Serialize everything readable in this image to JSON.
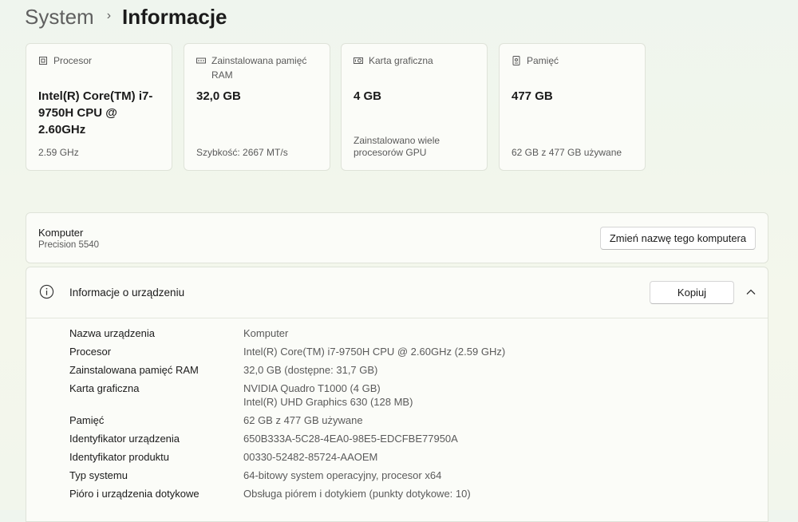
{
  "breadcrumb": {
    "parent": "System",
    "separator": "›",
    "current": "Informacje"
  },
  "cards": [
    {
      "icon": "cpu-icon",
      "label": "Procesor",
      "value": "Intel(R) Core(TM) i7-9750H CPU @ 2.60GHz",
      "detail": "2.59 GHz"
    },
    {
      "icon": "ram-icon",
      "label": "Zainstalowana pamięć RAM",
      "value": "32,0 GB",
      "detail": "Szybkość: 2667 MT/s"
    },
    {
      "icon": "gpu-icon",
      "label": "Karta graficzna",
      "value": "4 GB",
      "detail": "Zainstalowano wiele procesorów GPU"
    },
    {
      "icon": "storage-icon",
      "label": "Pamięć",
      "value": "477 GB",
      "detail": "62 GB z 477 GB używane"
    }
  ],
  "computer": {
    "name": "Komputer",
    "model": "Precision 5540",
    "rename_label": "Zmień nazwę tego komputera"
  },
  "device_info": {
    "title": "Informacje o urządzeniu",
    "copy_label": "Kopiuj",
    "rows": [
      {
        "label": "Nazwa urządzenia",
        "value": "Komputer"
      },
      {
        "label": "Procesor",
        "value": "Intel(R) Core(TM) i7-9750H CPU @ 2.60GHz (2.59 GHz)"
      },
      {
        "label": "Zainstalowana pamięć RAM",
        "value": "32,0 GB (dostępne: 31,7 GB)"
      },
      {
        "label": "Karta graficzna",
        "value": "NVIDIA Quadro T1000 (4 GB)",
        "value2": "Intel(R) UHD Graphics 630 (128 MB)"
      },
      {
        "label": "Pamięć",
        "value": "62 GB z 477 GB używane"
      },
      {
        "label": "Identyfikator urządzenia",
        "value": "650B333A-5C28-4EA0-98E5-EDCFBE77950A"
      },
      {
        "label": "Identyfikator produktu",
        "value": "00330-52482-85724-AAOEM"
      },
      {
        "label": "Typ systemu",
        "value": "64-bitowy system operacyjny, procesor x64"
      },
      {
        "label": "Pióro i urządzenia dotykowe",
        "value": "Obsługa piórem i dotykiem (punkty dotykowe: 10)"
      }
    ]
  }
}
